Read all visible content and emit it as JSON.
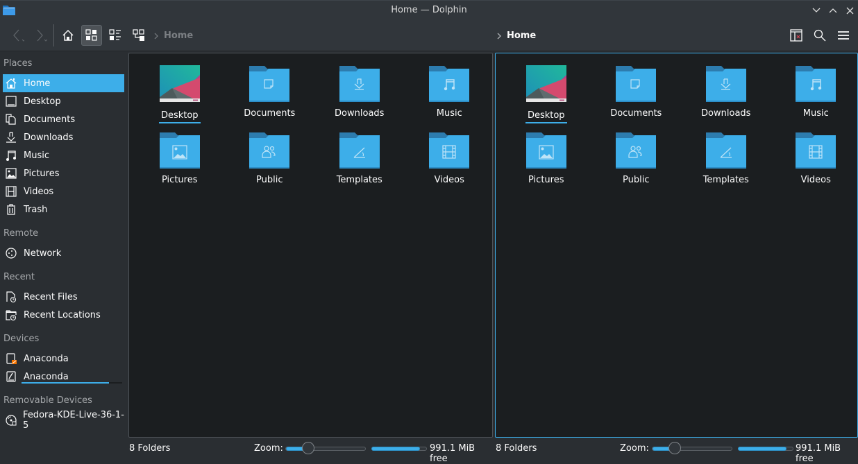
{
  "window": {
    "title": "Home — Dolphin",
    "controls": [
      "minimize",
      "maximize",
      "close"
    ]
  },
  "toolbar": {
    "back_icon": "go-back-icon",
    "forward_icon": "go-forward-icon",
    "home_icon": "home-icon",
    "view_modes": [
      "icons",
      "compact",
      "details"
    ],
    "active_view": "icons",
    "left_breadcrumb": "Home",
    "right_breadcrumb": "Home",
    "right_icons": [
      "split-view-close-icon",
      "search-icon",
      "hamburger-menu-icon"
    ]
  },
  "sidebar": {
    "sections": [
      {
        "title": "Places",
        "items": [
          {
            "label": "Home",
            "icon": "home-icon",
            "selected": true
          },
          {
            "label": "Desktop",
            "icon": "desktop-icon"
          },
          {
            "label": "Documents",
            "icon": "documents-icon"
          },
          {
            "label": "Downloads",
            "icon": "downloads-icon"
          },
          {
            "label": "Music",
            "icon": "music-icon"
          },
          {
            "label": "Pictures",
            "icon": "pictures-icon"
          },
          {
            "label": "Videos",
            "icon": "videos-icon"
          },
          {
            "label": "Trash",
            "icon": "trash-icon"
          }
        ]
      },
      {
        "title": "Remote",
        "items": [
          {
            "label": "Network",
            "icon": "network-icon"
          }
        ]
      },
      {
        "title": "Recent",
        "items": [
          {
            "label": "Recent Files",
            "icon": "recent-files-icon"
          },
          {
            "label": "Recent Locations",
            "icon": "recent-locations-icon"
          }
        ]
      },
      {
        "title": "Devices",
        "items": [
          {
            "label": "Anaconda",
            "icon": "drive-unmounted-icon"
          },
          {
            "label": "Anaconda",
            "icon": "drive-mounted-icon",
            "usage": 0.87
          }
        ]
      },
      {
        "title": "Removable Devices",
        "items": [
          {
            "label": "Fedora-KDE-Live-36-1-5",
            "icon": "optical-disc-icon"
          }
        ]
      }
    ]
  },
  "panes": [
    {
      "id": "left",
      "items": [
        {
          "name": "Desktop",
          "type": "desktop",
          "focused": true
        },
        {
          "name": "Documents",
          "type": "documents"
        },
        {
          "name": "Downloads",
          "type": "downloads"
        },
        {
          "name": "Music",
          "type": "music"
        },
        {
          "name": "Pictures",
          "type": "pictures"
        },
        {
          "name": "Public",
          "type": "public"
        },
        {
          "name": "Templates",
          "type": "templates"
        },
        {
          "name": "Videos",
          "type": "videos"
        }
      ],
      "status": {
        "count": "8 Folders",
        "zoom_label": "Zoom:",
        "zoom_level": 0.28,
        "free_space": "991.1 MiB free",
        "used_fraction": 0.87
      }
    },
    {
      "id": "right",
      "active": true,
      "items": [
        {
          "name": "Desktop",
          "type": "desktop",
          "focused": true
        },
        {
          "name": "Documents",
          "type": "documents"
        },
        {
          "name": "Downloads",
          "type": "downloads"
        },
        {
          "name": "Music",
          "type": "music"
        },
        {
          "name": "Pictures",
          "type": "pictures"
        },
        {
          "name": "Public",
          "type": "public"
        },
        {
          "name": "Templates",
          "type": "templates"
        },
        {
          "name": "Videos",
          "type": "videos"
        }
      ],
      "status": {
        "count": "8 Folders",
        "zoom_label": "Zoom:",
        "zoom_level": 0.28,
        "free_space": "991.1 MiB free",
        "used_fraction": 0.87
      }
    }
  ],
  "colors": {
    "accent": "#3daee9",
    "folder": "#3daee9",
    "folder_tab": "#2980b9",
    "window_bg": "#2a2e32",
    "view_bg": "#1b1e20"
  }
}
